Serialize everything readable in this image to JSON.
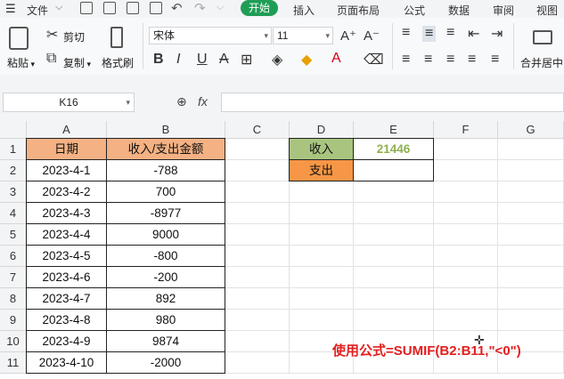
{
  "menubar": {
    "file": "文件",
    "tabs": [
      "开始",
      "插入",
      "页面布局",
      "公式",
      "数据",
      "审阅",
      "视图"
    ]
  },
  "ribbon": {
    "paste": "粘贴",
    "cut": "剪切",
    "copy": "复制",
    "format_painter": "格式刷",
    "font_name": "宋体",
    "font_size": "11",
    "merge": "合并居中"
  },
  "formula_bar": {
    "cell_ref": "K16",
    "fx": "fx",
    "content": ""
  },
  "grid": {
    "columns": [
      "A",
      "B",
      "C",
      "D",
      "E",
      "F",
      "G"
    ],
    "rows": [
      "1",
      "2",
      "3",
      "4",
      "5",
      "6",
      "7",
      "8",
      "9",
      "10",
      "11"
    ],
    "header_a": "日期",
    "header_b": "收入/支出金额",
    "records": [
      {
        "date": "2023-4-1",
        "amount": "-788"
      },
      {
        "date": "2023-4-2",
        "amount": "700"
      },
      {
        "date": "2023-4-3",
        "amount": "-8977"
      },
      {
        "date": "2023-4-4",
        "amount": "9000"
      },
      {
        "date": "2023-4-5",
        "amount": "-800"
      },
      {
        "date": "2023-4-6",
        "amount": "-200"
      },
      {
        "date": "2023-4-7",
        "amount": "892"
      },
      {
        "date": "2023-4-8",
        "amount": "980"
      },
      {
        "date": "2023-4-9",
        "amount": "9874"
      },
      {
        "date": "2023-4-10",
        "amount": "-2000"
      }
    ],
    "income_label": "收入",
    "income_value": "21446",
    "expense_label": "支出",
    "expense_value": ""
  },
  "colors": {
    "header_orange": "#f4b183",
    "income_green": "#a9c47f",
    "income_value_green": "#8fb04d",
    "expense_orange": "#f79646",
    "accent": "#1f9d55",
    "annotation_red": "#e41e1e"
  },
  "annotation": "使用公式=SUMIF(B2:B11,\"<0\")"
}
